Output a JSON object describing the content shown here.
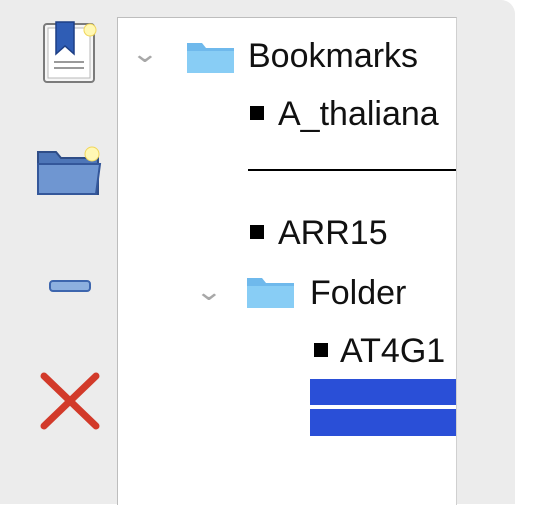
{
  "tree": {
    "root_label": "Bookmarks",
    "items": [
      {
        "type": "bookmark",
        "label": "A_thaliana"
      },
      {
        "type": "separator"
      },
      {
        "type": "bookmark",
        "label": "ARR15"
      },
      {
        "type": "folder",
        "label": "Folder",
        "children": [
          {
            "type": "bookmark",
            "label": "AT4G1"
          },
          {
            "type": "separator",
            "selected": true
          }
        ]
      }
    ]
  },
  "toolbar": {
    "icons": [
      "add-bookmark-icon",
      "add-folder-icon",
      "add-separator-icon",
      "delete-icon"
    ]
  },
  "colors": {
    "selection": "#2a4fd7",
    "folder": "#7fc7f2",
    "delete": "#d23a2a"
  }
}
